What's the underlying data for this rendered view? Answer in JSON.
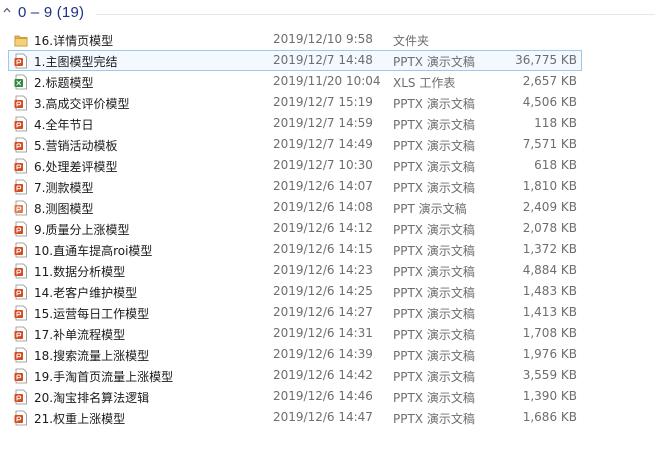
{
  "group": {
    "title": "0 – 9 (19)",
    "chevron_icon": "chevron-up-icon"
  },
  "colors": {
    "header_text": "#1e3287",
    "selection_border": "#9ec8ea",
    "pptx_icon": "#d34b20",
    "xls_icon": "#2e8b3a",
    "folder_icon": "#e8b84a"
  },
  "files": [
    {
      "name": "16.详情页模型",
      "date": "2019/12/10 9:58",
      "type": "文件夹",
      "size": "",
      "icon": "folder-icon"
    },
    {
      "name": "1.主图模型完结",
      "date": "2019/12/7 14:48",
      "type": "PPTX 演示文稿",
      "size": "36,775 KB",
      "icon": "pptx-icon",
      "selected": true
    },
    {
      "name": "2.标题模型",
      "date": "2019/11/20 10:04",
      "type": "XLS 工作表",
      "size": "2,657 KB",
      "icon": "xls-icon"
    },
    {
      "name": "3.高成交评价模型",
      "date": "2019/12/7 15:19",
      "type": "PPTX 演示文稿",
      "size": "4,506 KB",
      "icon": "pptx-icon"
    },
    {
      "name": "4.全年节日",
      "date": "2019/12/7 14:59",
      "type": "PPTX 演示文稿",
      "size": "118 KB",
      "icon": "pptx-icon"
    },
    {
      "name": "5.营销活动模板",
      "date": "2019/12/7 14:49",
      "type": "PPTX 演示文稿",
      "size": "7,571 KB",
      "icon": "pptx-icon"
    },
    {
      "name": "6.处理差评模型",
      "date": "2019/12/7 10:30",
      "type": "PPTX 演示文稿",
      "size": "618 KB",
      "icon": "pptx-icon"
    },
    {
      "name": "7.测款模型",
      "date": "2019/12/6 14:07",
      "type": "PPTX 演示文稿",
      "size": "1,810 KB",
      "icon": "pptx-icon"
    },
    {
      "name": "8.测图模型",
      "date": "2019/12/6 14:08",
      "type": "PPT 演示文稿",
      "size": "2,409 KB",
      "icon": "ppt-icon"
    },
    {
      "name": "9.质量分上涨模型",
      "date": "2019/12/6 14:12",
      "type": "PPTX 演示文稿",
      "size": "2,078 KB",
      "icon": "pptx-icon"
    },
    {
      "name": "10.直通车提高roi模型",
      "date": "2019/12/6 14:15",
      "type": "PPTX 演示文稿",
      "size": "1,372 KB",
      "icon": "pptx-icon"
    },
    {
      "name": "11.数据分析模型",
      "date": "2019/12/6 14:23",
      "type": "PPTX 演示文稿",
      "size": "4,884 KB",
      "icon": "pptx-icon"
    },
    {
      "name": "14.老客户维护模型",
      "date": "2019/12/6 14:25",
      "type": "PPTX 演示文稿",
      "size": "1,483 KB",
      "icon": "pptx-icon"
    },
    {
      "name": "15.运营每日工作模型",
      "date": "2019/12/6 14:27",
      "type": "PPTX 演示文稿",
      "size": "1,413 KB",
      "icon": "pptx-icon"
    },
    {
      "name": "17.补单流程模型",
      "date": "2019/12/6 14:31",
      "type": "PPTX 演示文稿",
      "size": "1,708 KB",
      "icon": "pptx-icon"
    },
    {
      "name": "18.搜索流量上涨模型",
      "date": "2019/12/6 14:39",
      "type": "PPTX 演示文稿",
      "size": "1,976 KB",
      "icon": "pptx-icon"
    },
    {
      "name": "19.手淘首页流量上涨模型",
      "date": "2019/12/6 14:42",
      "type": "PPTX 演示文稿",
      "size": "3,559 KB",
      "icon": "pptx-icon"
    },
    {
      "name": "20.淘宝排名算法逻辑",
      "date": "2019/12/6 14:46",
      "type": "PPTX 演示文稿",
      "size": "1,390 KB",
      "icon": "pptx-icon"
    },
    {
      "name": "21.权重上涨模型",
      "date": "2019/12/6 14:47",
      "type": "PPTX 演示文稿",
      "size": "1,686 KB",
      "icon": "pptx-icon"
    }
  ]
}
